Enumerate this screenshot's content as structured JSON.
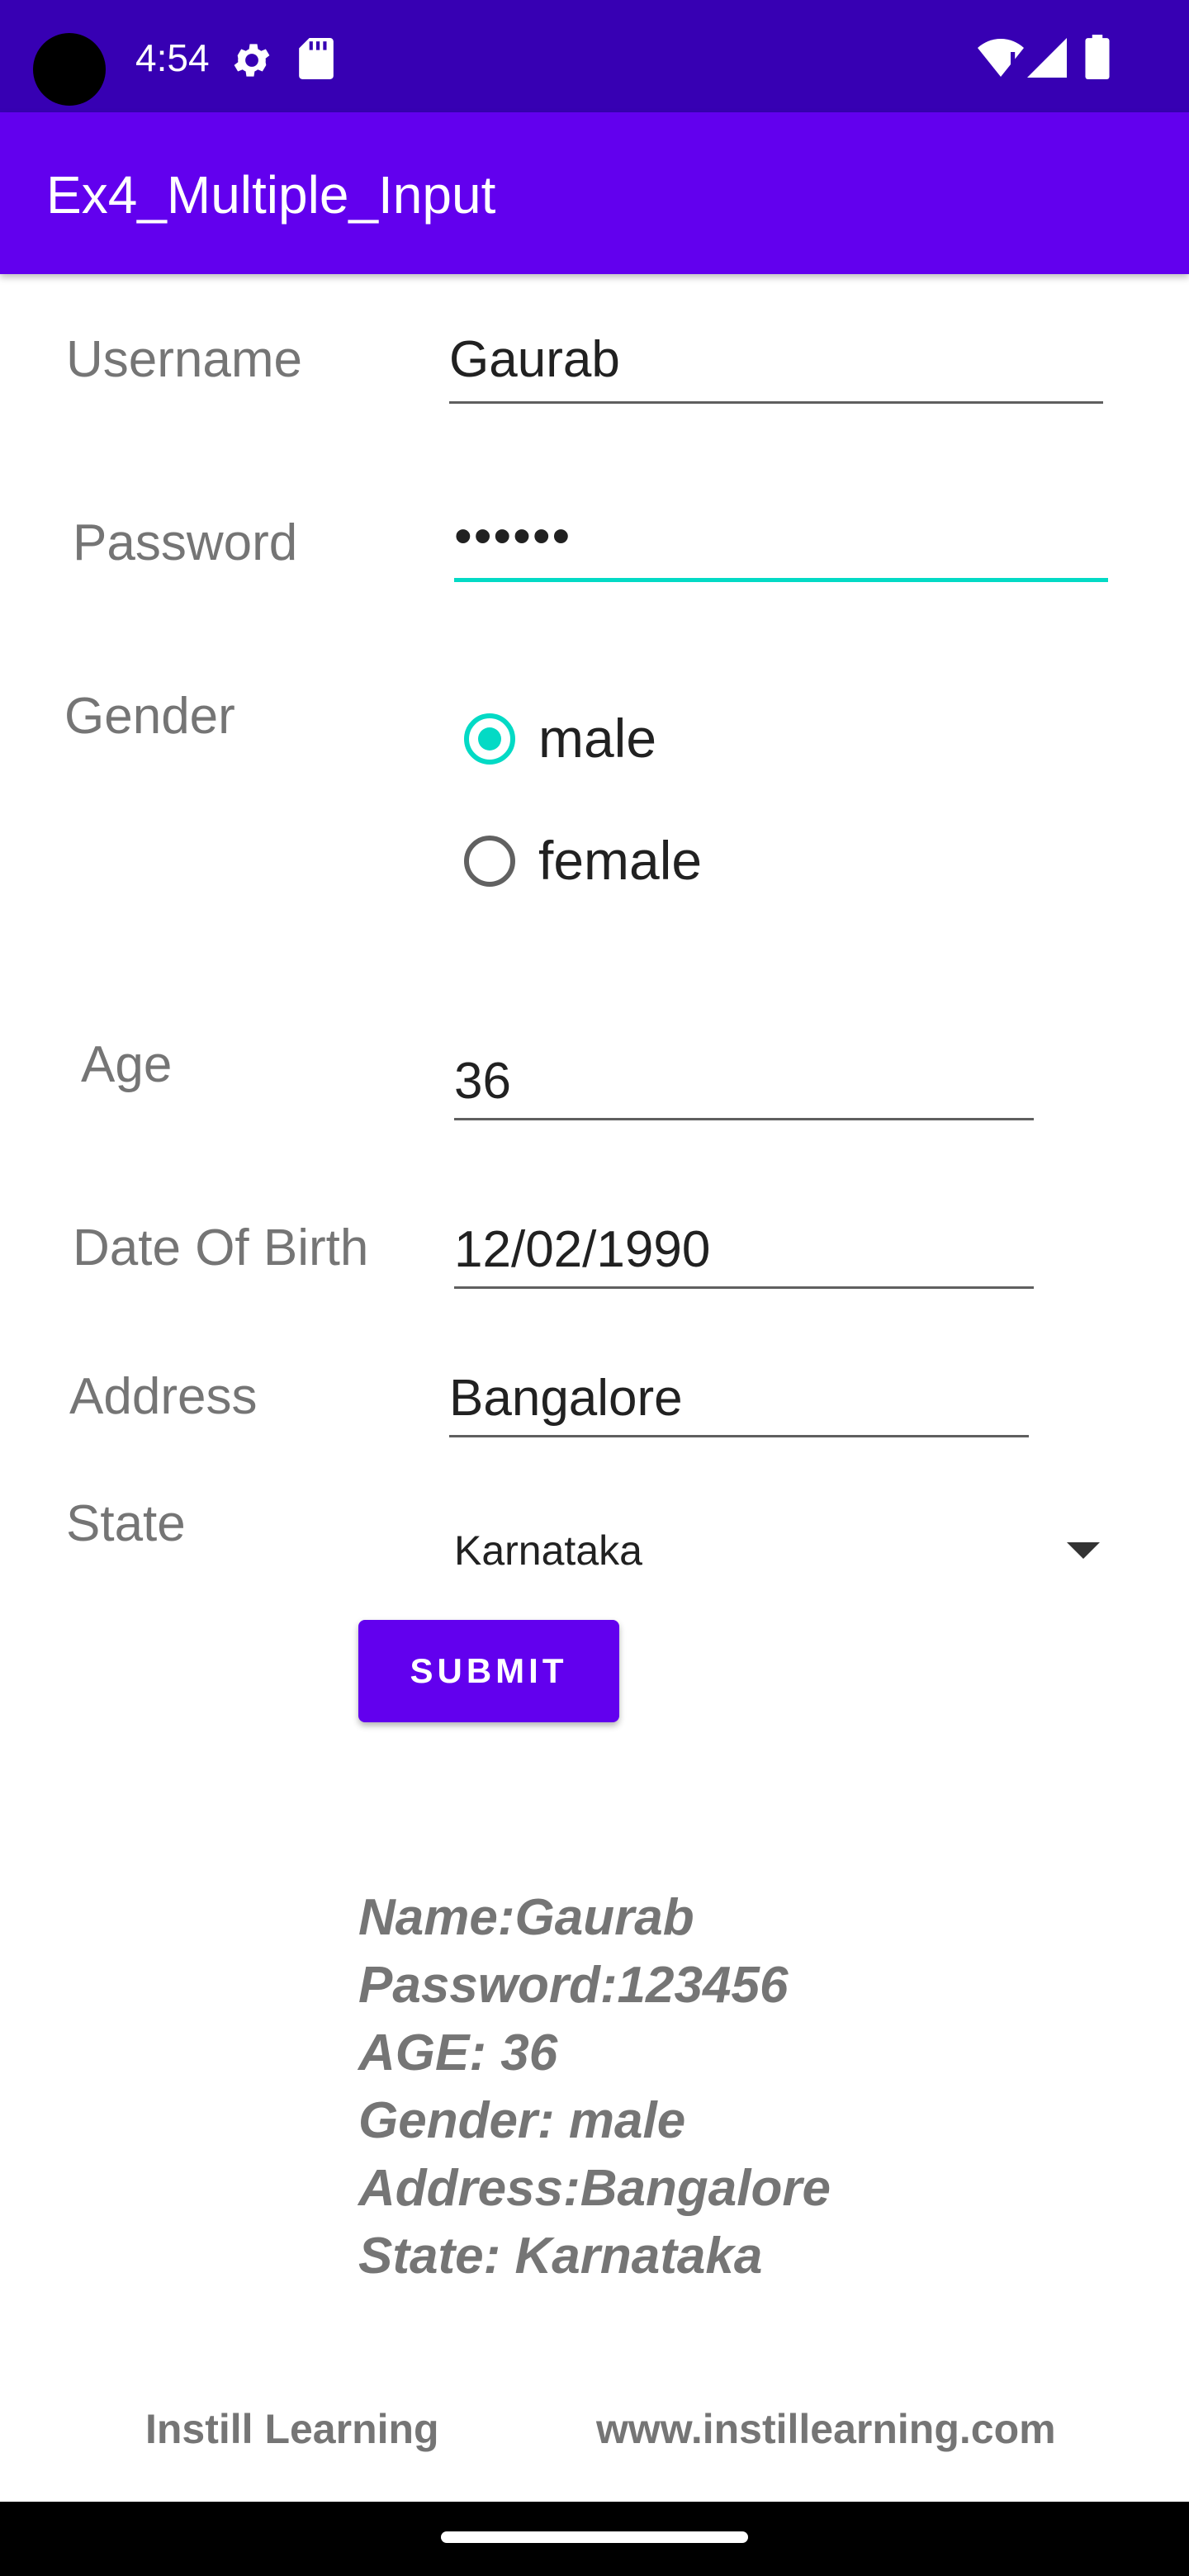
{
  "status_bar": {
    "time": "4:54",
    "icons": [
      "camera-cutout",
      "gear-icon",
      "sdcard-icon",
      "wifi-icon",
      "signal-icon",
      "battery-icon"
    ]
  },
  "app_bar": {
    "title": "Ex4_Multiple_Input"
  },
  "form": {
    "username": {
      "label": "Username",
      "value": "Gaurab"
    },
    "password": {
      "label": "Password",
      "value": "••••••"
    },
    "gender": {
      "label": "Gender",
      "options": [
        {
          "label": "male",
          "selected": true
        },
        {
          "label": "female",
          "selected": false
        }
      ]
    },
    "age": {
      "label": "Age",
      "value": "36"
    },
    "dob": {
      "label": "Date Of Birth",
      "value": "12/02/1990"
    },
    "address": {
      "label": "Address",
      "value": "Bangalore"
    },
    "state": {
      "label": "State",
      "selected": "Karnataka"
    },
    "submit_label": "SUBMIT"
  },
  "result": {
    "lines": [
      "Name:Gaurab",
      "Password:123456",
      "AGE: 36",
      "Gender: male",
      "Address:Bangalore",
      "State: Karnataka"
    ]
  },
  "footer": {
    "left": "Instill Learning",
    "right": "www.instillearning.com"
  },
  "colors": {
    "status_bar": "#3700B3",
    "primary": "#6200EE",
    "accent": "#03DAC5",
    "label_gray": "#757575"
  }
}
